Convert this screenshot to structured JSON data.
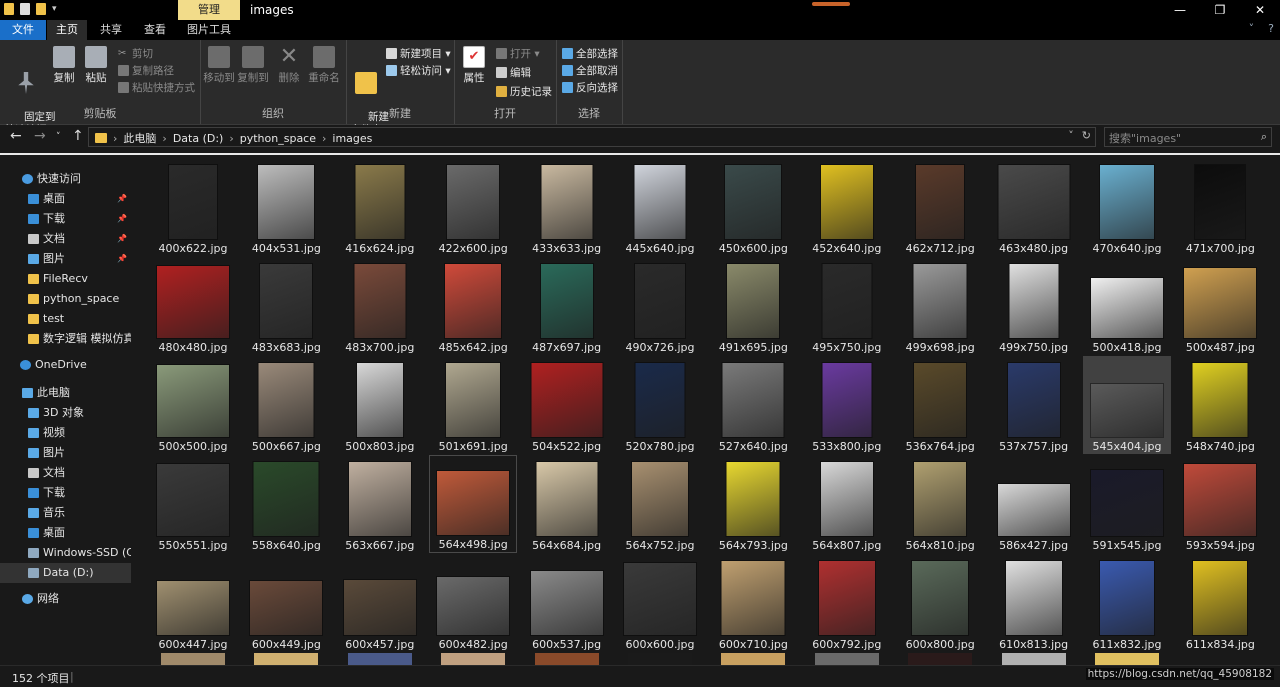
{
  "window": {
    "title": "images",
    "manage_tab": "管理",
    "controls": [
      "—",
      "❐",
      "✕"
    ],
    "tabs": [
      {
        "label": "文件"
      },
      {
        "label": "主页"
      },
      {
        "label": "共享"
      },
      {
        "label": "查看"
      },
      {
        "label": "图片工具"
      }
    ]
  },
  "ribbon": {
    "clipboard": {
      "pin": "固定到\n快速访问",
      "copy": "复制",
      "paste": "粘贴",
      "cut": "剪切",
      "copy_path": "复制路径",
      "paste_shortcut": "粘贴快捷方式",
      "label": "剪贴板"
    },
    "organize": {
      "move_to": "移动到",
      "copy_to": "复制到",
      "delete": "删除",
      "rename": "重命名",
      "label": "组织"
    },
    "new": {
      "new_folder": "新建\n文件夹",
      "new_item": "新建项目 ▾",
      "easy_access": "轻松访问 ▾",
      "label": "新建"
    },
    "open": {
      "properties": "属性",
      "open": "打开 ▾",
      "edit": "编辑",
      "history": "历史记录",
      "label": "打开"
    },
    "select": {
      "select_all": "全部选择",
      "select_none": "全部取消",
      "invert": "反向选择",
      "label": "选择"
    }
  },
  "address": {
    "crumbs": [
      "此电脑",
      "Data (D:)",
      "python_space",
      "images"
    ],
    "search_placeholder": "搜索\"images\""
  },
  "nav": {
    "items": [
      {
        "label": "快速访问",
        "icon": "star-icon",
        "color": "#4a9be0",
        "pinned": false
      },
      {
        "label": "桌面",
        "icon": "desktop-icon",
        "color": "#3a8fd8",
        "pinned": true
      },
      {
        "label": "下载",
        "icon": "download-icon",
        "color": "#3a8fd8",
        "pinned": true
      },
      {
        "label": "文档",
        "icon": "document-icon",
        "color": "#c9c9c9",
        "pinned": true
      },
      {
        "label": "图片",
        "icon": "picture-icon",
        "color": "#5aa9e6",
        "pinned": true
      },
      {
        "label": "FileRecv",
        "icon": "folder-icon",
        "color": "#f0c24a",
        "pinned": false
      },
      {
        "label": "python_space",
        "icon": "folder-icon",
        "color": "#f0c24a",
        "pinned": false
      },
      {
        "label": "test",
        "icon": "folder-icon",
        "color": "#f0c24a",
        "pinned": false
      },
      {
        "label": "数字逻辑 模拟仿真软",
        "icon": "folder-icon",
        "color": "#f0c24a",
        "pinned": false
      },
      {
        "label": "OneDrive",
        "icon": "cloud-icon",
        "color": "#3a8fd8",
        "pinned": false
      },
      {
        "label": "此电脑",
        "icon": "computer-icon",
        "color": "#5aa9e6",
        "pinned": false
      },
      {
        "label": "3D 对象",
        "icon": "cube-icon",
        "color": "#5aa9e6",
        "pinned": false
      },
      {
        "label": "视频",
        "icon": "video-icon",
        "color": "#5aa9e6",
        "pinned": false
      },
      {
        "label": "图片",
        "icon": "picture-icon",
        "color": "#5aa9e6",
        "pinned": false
      },
      {
        "label": "文档",
        "icon": "document-icon",
        "color": "#c9c9c9",
        "pinned": false
      },
      {
        "label": "下载",
        "icon": "download-icon",
        "color": "#3a8fd8",
        "pinned": false
      },
      {
        "label": "音乐",
        "icon": "music-icon",
        "color": "#5aa9e6",
        "pinned": false
      },
      {
        "label": "桌面",
        "icon": "desktop-icon",
        "color": "#3a8fd8",
        "pinned": false
      },
      {
        "label": "Windows-SSD (C:)",
        "icon": "drive-icon",
        "color": "#8fa9c0",
        "pinned": false
      },
      {
        "label": "Data (D:)",
        "icon": "drive-icon",
        "color": "#8fa9c0",
        "pinned": false
      },
      {
        "label": "网络",
        "icon": "network-icon",
        "color": "#5aa9e6",
        "pinned": false
      }
    ]
  },
  "files": [
    {
      "name": "400x622.jpg",
      "color": "#2a2a2a"
    },
    {
      "name": "404x531.jpg",
      "color": "#bdbdbd"
    },
    {
      "name": "416x624.jpg",
      "color": "#8a7a4a"
    },
    {
      "name": "422x600.jpg",
      "color": "#6a6a6a"
    },
    {
      "name": "433x633.jpg",
      "color": "#c9b9a0"
    },
    {
      "name": "445x640.jpg",
      "color": "#d0d4dc"
    },
    {
      "name": "450x600.jpg",
      "color": "#3a4a4a"
    },
    {
      "name": "452x640.jpg",
      "color": "#e0c020"
    },
    {
      "name": "462x712.jpg",
      "color": "#5a3a2a"
    },
    {
      "name": "463x480.jpg",
      "color": "#4a4a4a"
    },
    {
      "name": "470x640.jpg",
      "color": "#6ab0d0"
    },
    {
      "name": "471x700.jpg",
      "color": "#0c0c0c"
    },
    {
      "name": "480x480.jpg",
      "color": "#b02020"
    },
    {
      "name": "483x683.jpg",
      "color": "#3a3a3a"
    },
    {
      "name": "483x700.jpg",
      "color": "#7a4a3a"
    },
    {
      "name": "485x642.jpg",
      "color": "#d04a3a"
    },
    {
      "name": "487x697.jpg",
      "color": "#2a6a5a"
    },
    {
      "name": "490x726.jpg",
      "color": "#2a2a2a"
    },
    {
      "name": "491x695.jpg",
      "color": "#8a8a6a"
    },
    {
      "name": "495x750.jpg",
      "color": "#2a2a2a"
    },
    {
      "name": "499x698.jpg",
      "color": "#9a9a9a"
    },
    {
      "name": "499x750.jpg",
      "color": "#e0e0e0"
    },
    {
      "name": "500x418.jpg",
      "color": "#f0f0f0"
    },
    {
      "name": "500x487.jpg",
      "color": "#d0a050"
    },
    {
      "name": "500x500.jpg",
      "color": "#8a9a7a"
    },
    {
      "name": "500x667.jpg",
      "color": "#9a8a7a"
    },
    {
      "name": "500x803.jpg",
      "color": "#d8d8d8"
    },
    {
      "name": "501x691.jpg",
      "color": "#b0a890"
    },
    {
      "name": "504x522.jpg",
      "color": "#b02020"
    },
    {
      "name": "520x780.jpg",
      "color": "#1a2a4a"
    },
    {
      "name": "527x640.jpg",
      "color": "#7a7a7a"
    },
    {
      "name": "533x800.jpg",
      "color": "#6a3aa0"
    },
    {
      "name": "536x764.jpg",
      "color": "#5a4a2a"
    },
    {
      "name": "537x757.jpg",
      "color": "#2a3a6a"
    },
    {
      "name": "545x404.jpg",
      "color": "#5a5a5a"
    },
    {
      "name": "548x740.jpg",
      "color": "#e0d020"
    },
    {
      "name": "550x551.jpg",
      "color": "#3a3a3a"
    },
    {
      "name": "558x640.jpg",
      "color": "#2a4a2a"
    },
    {
      "name": "563x667.jpg",
      "color": "#c0b0a0"
    },
    {
      "name": "564x498.jpg",
      "color": "#c05a3a"
    },
    {
      "name": "564x684.jpg",
      "color": "#d8c8a8"
    },
    {
      "name": "564x752.jpg",
      "color": "#a89070"
    },
    {
      "name": "564x793.jpg",
      "color": "#e8d830"
    },
    {
      "name": "564x807.jpg",
      "color": "#d8d8d8"
    },
    {
      "name": "564x810.jpg",
      "color": "#b0a070"
    },
    {
      "name": "586x427.jpg",
      "color": "#d8d8d8"
    },
    {
      "name": "591x545.jpg",
      "color": "#1a1a2a"
    },
    {
      "name": "593x594.jpg",
      "color": "#c04a3a"
    },
    {
      "name": "600x447.jpg",
      "color": "#a09070"
    },
    {
      "name": "600x449.jpg",
      "color": "#6a4a3a"
    },
    {
      "name": "600x457.jpg",
      "color": "#5a4a3a"
    },
    {
      "name": "600x482.jpg",
      "color": "#6a6a6a"
    },
    {
      "name": "600x537.jpg",
      "color": "#8a8a8a"
    },
    {
      "name": "600x600.jpg",
      "color": "#3a3a3a"
    },
    {
      "name": "600x710.jpg",
      "color": "#c0a070"
    },
    {
      "name": "600x792.jpg",
      "color": "#b03030"
    },
    {
      "name": "600x800.jpg",
      "color": "#5a6a5a"
    },
    {
      "name": "610x813.jpg",
      "color": "#e0e0e0"
    },
    {
      "name": "611x832.jpg",
      "color": "#3a5ab0"
    },
    {
      "name": "611x834.jpg",
      "color": "#e0c020"
    }
  ],
  "status": {
    "count": "152 个项目",
    "watermark": "https://blog.csdn.net/qq_45908182"
  }
}
